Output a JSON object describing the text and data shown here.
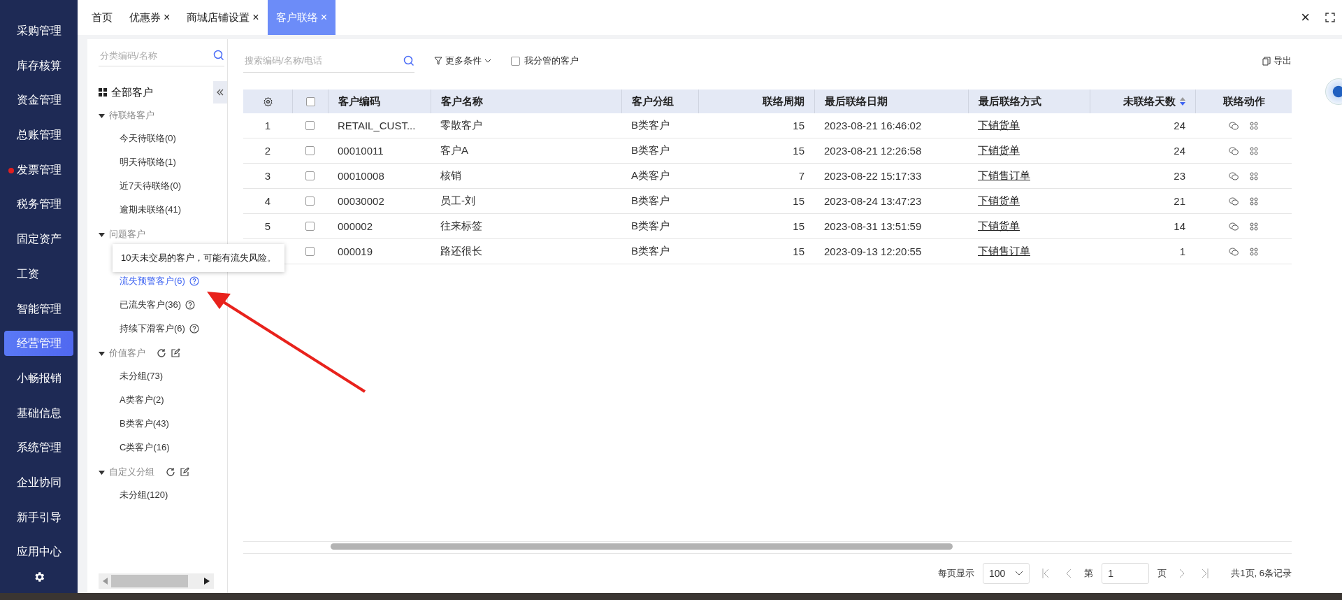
{
  "nav": {
    "items": [
      {
        "label": "采购管理",
        "selected": false,
        "dot": false
      },
      {
        "label": "库存核算",
        "selected": false,
        "dot": false
      },
      {
        "label": "资金管理",
        "selected": false,
        "dot": false
      },
      {
        "label": "总账管理",
        "selected": false,
        "dot": false
      },
      {
        "label": "发票管理",
        "selected": false,
        "dot": true
      },
      {
        "label": "税务管理",
        "selected": false,
        "dot": false
      },
      {
        "label": "固定资产",
        "selected": false,
        "dot": false
      },
      {
        "label": "工资",
        "selected": false,
        "dot": false
      },
      {
        "label": "智能管理",
        "selected": false,
        "dot": false
      },
      {
        "label": "经营管理",
        "selected": true,
        "dot": false
      },
      {
        "label": "小畅报销",
        "selected": false,
        "dot": false
      },
      {
        "label": "基础信息",
        "selected": false,
        "dot": false
      },
      {
        "label": "系统管理",
        "selected": false,
        "dot": false
      },
      {
        "label": "企业协同",
        "selected": false,
        "dot": false
      },
      {
        "label": "新手引导",
        "selected": false,
        "dot": false
      },
      {
        "label": "应用中心",
        "selected": false,
        "dot": false
      }
    ]
  },
  "tabs": [
    {
      "label": "首页",
      "closable": false,
      "selected": false
    },
    {
      "label": "优惠券",
      "closable": true,
      "selected": false
    },
    {
      "label": "商城店铺设置",
      "closable": true,
      "selected": false
    },
    {
      "label": "客户联络",
      "closable": true,
      "selected": true
    }
  ],
  "close_symbol": "×",
  "tree": {
    "search": {
      "placeholder": "分类编码/名称"
    },
    "root": "全部客户",
    "groups": [
      {
        "label": "待联络客户",
        "editable": false,
        "expanded": true,
        "children": [
          {
            "label": "今天待联络(0)",
            "help": false,
            "selected": false
          },
          {
            "label": "明天待联络(1)",
            "help": false,
            "selected": false
          },
          {
            "label": "近7天待联络(0)",
            "help": false,
            "selected": false
          },
          {
            "label": "逾期未联络(41)",
            "help": false,
            "selected": false
          }
        ]
      },
      {
        "label": "问题客户",
        "editable": false,
        "expanded": true,
        "children": [
          {
            "label": "流失预警客户(6)",
            "help": true,
            "selected": true
          },
          {
            "label": "已流失客户(36)",
            "help": true,
            "selected": false
          },
          {
            "label": "持续下滑客户(6)",
            "help": true,
            "selected": false
          }
        ]
      },
      {
        "label": "价值客户",
        "editable": true,
        "expanded": true,
        "children": [
          {
            "label": "未分组(73)",
            "help": false,
            "selected": false
          },
          {
            "label": "A类客户(2)",
            "help": false,
            "selected": false
          },
          {
            "label": "B类客户(43)",
            "help": false,
            "selected": false
          },
          {
            "label": "C类客户(16)",
            "help": false,
            "selected": false
          }
        ]
      },
      {
        "label": "自定义分组",
        "editable": true,
        "expanded": true,
        "children": [
          {
            "label": "未分组(120)",
            "help": false,
            "selected": false
          }
        ]
      }
    ],
    "tooltip": "10天未交易的客户，可能有流失风险。"
  },
  "toolbar": {
    "search": {
      "placeholder": "搜索编码/名称/电话"
    },
    "filter": "更多条件",
    "mine": {
      "label": "我分管的客户",
      "checked": false
    },
    "export": "导出"
  },
  "table": {
    "columns": [
      {
        "label": "客户编码",
        "sorted": false
      },
      {
        "label": "客户名称",
        "sorted": false
      },
      {
        "label": "客户分组",
        "sorted": false
      },
      {
        "label": "联络周期",
        "sorted": false
      },
      {
        "label": "最后联络日期",
        "sorted": false
      },
      {
        "label": "最后联络方式",
        "sorted": false
      },
      {
        "label": "未联络天数",
        "sorted": true
      },
      {
        "label": "联络动作",
        "sorted": false
      }
    ],
    "select_all_checked": false,
    "rows": [
      {
        "no": "1",
        "checked": false,
        "cells": [
          "RETAIL_CUST...",
          "零散客户",
          "B类客户",
          "15",
          "2023-08-21 16:46:02",
          "下销货单",
          "24"
        ]
      },
      {
        "no": "2",
        "checked": false,
        "cells": [
          "00010011",
          "客户A",
          "B类客户",
          "15",
          "2023-08-21 12:26:58",
          "下销货单",
          "24"
        ]
      },
      {
        "no": "3",
        "checked": false,
        "cells": [
          "00010008",
          "核销",
          "A类客户",
          "7",
          "2023-08-22 15:17:33",
          "下销售订单",
          "23"
        ]
      },
      {
        "no": "4",
        "checked": false,
        "cells": [
          "00030002",
          "员工-刘",
          "B类客户",
          "15",
          "2023-08-24 13:47:23",
          "下销货单",
          "21"
        ]
      },
      {
        "no": "5",
        "checked": false,
        "cells": [
          "000002",
          "往来标签",
          "B类客户",
          "15",
          "2023-08-31 13:51:59",
          "下销货单",
          "14"
        ]
      },
      {
        "checked": false,
        "cells": [
          "000019",
          "路还很长",
          "B类客户",
          "15",
          "2023-09-13 12:20:55",
          "下销售订单",
          "1"
        ]
      }
    ]
  },
  "pagination": {
    "page_size_label": "每页显示",
    "page_size": "100",
    "page_prefix": "第",
    "page": "1",
    "page_suffix": "页",
    "summary": "共1页, 6条记录"
  }
}
